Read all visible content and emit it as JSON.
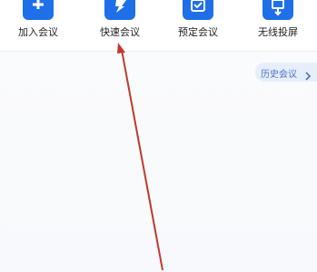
{
  "actions": [
    {
      "label": "加入会议",
      "icon": "plus-icon"
    },
    {
      "label": "快速会议",
      "icon": "lightning-icon"
    },
    {
      "label": "预定会议",
      "icon": "calendar-check-icon"
    },
    {
      "label": "无线投屏",
      "icon": "cast-screen-icon"
    }
  ],
  "history": {
    "label": "历史会议",
    "icon": "chevron-right-icon"
  },
  "colors": {
    "accent": "#1f6fe8",
    "annotation_arrow": "#c0392b",
    "history_text": "#4a72c4",
    "history_bg": "#e7eefb"
  }
}
